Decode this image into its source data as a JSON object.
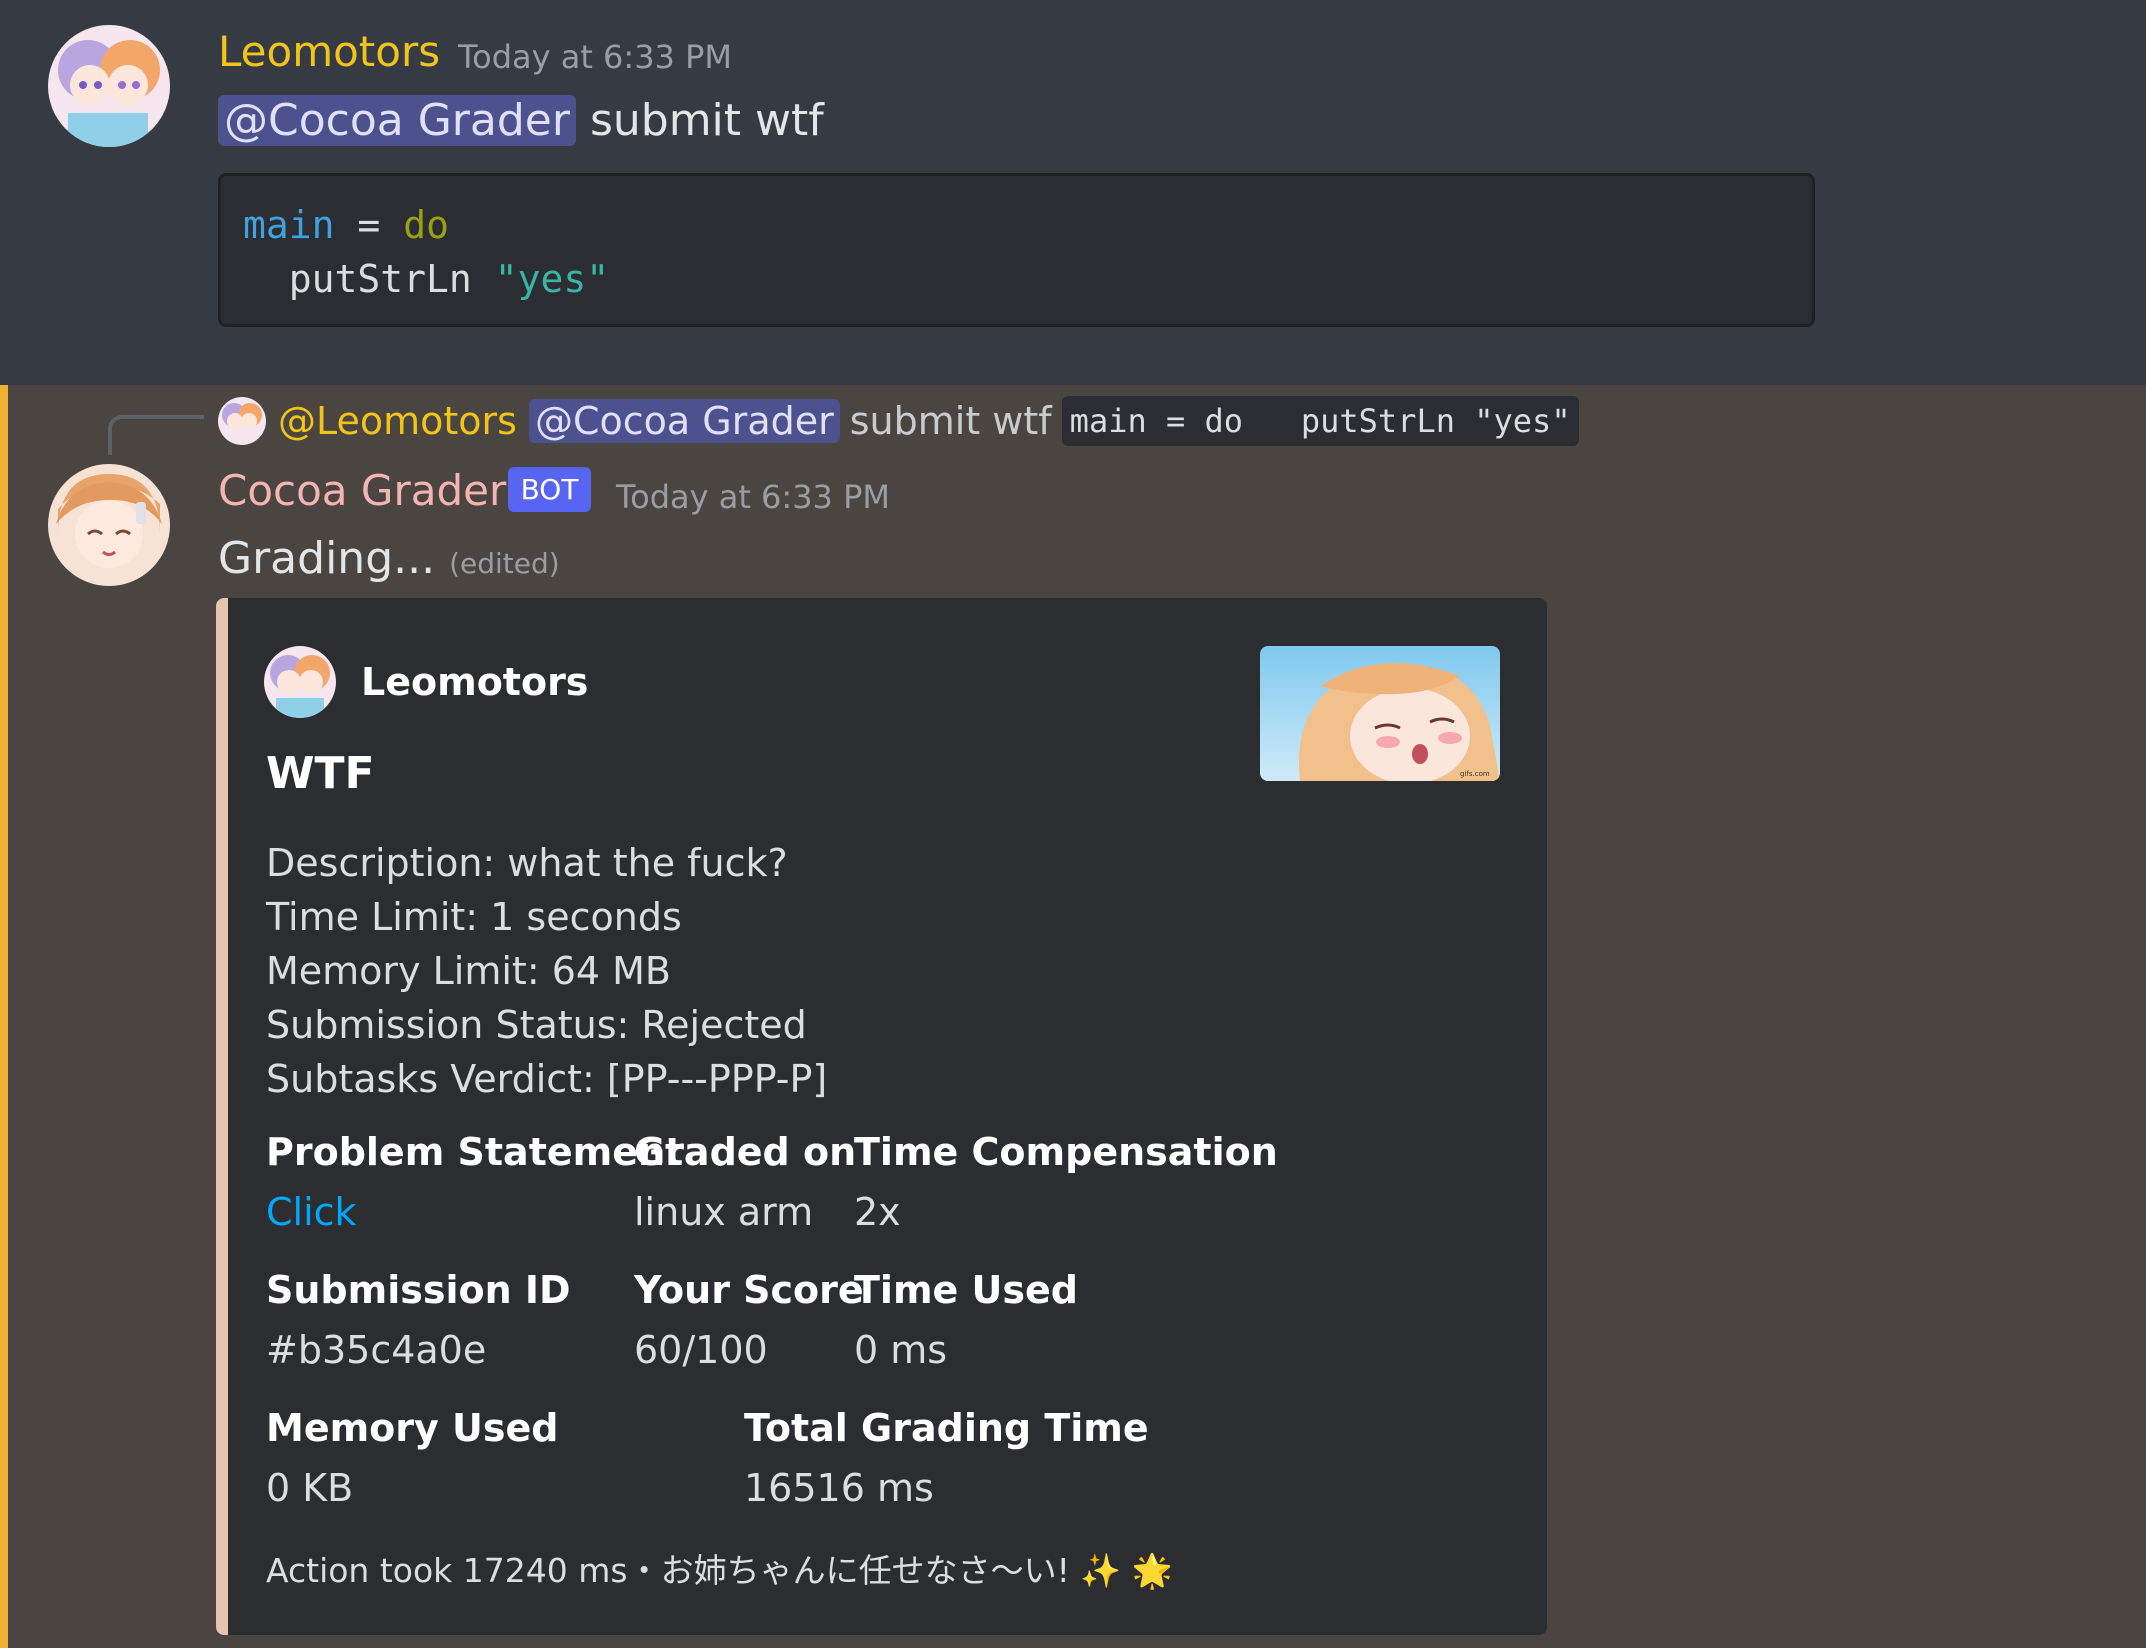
{
  "message1": {
    "author": "Leomotors",
    "timestamp": "Today at 6:33 PM",
    "mention": "@Cocoa Grader",
    "text": "submit wtf",
    "code_line1_a": "main",
    "code_line1_b": "=",
    "code_line1_c": "do",
    "code_line2_a": "putStrLn",
    "code_line2_b": "\"yes\""
  },
  "message2": {
    "reply_author": "@Leomotors",
    "reply_mention": "@Cocoa Grader",
    "reply_text": "submit wtf",
    "reply_code": "main = do   putStrLn \"yes\"",
    "author": "Cocoa Grader",
    "bot_tag": "BOT",
    "timestamp": "Today at 6:33 PM",
    "text": "Grading...",
    "edited": "(edited)"
  },
  "embed": {
    "author": "Leomotors",
    "title": "WTF",
    "description": [
      "Description: what the fuck?",
      "Time Limit: 1 seconds",
      "Memory Limit: 64 MB",
      "Submission Status: Rejected",
      "Subtasks Verdict: [PP---PPP-P]"
    ],
    "fields": {
      "problem_statement": {
        "name": "Problem Statement",
        "value": "Click"
      },
      "graded_on": {
        "name": "Graded on",
        "value": "linux arm"
      },
      "time_compensation": {
        "name": "Time Compensation",
        "value": "2x"
      },
      "submission_id": {
        "name": "Submission ID",
        "value": "#b35c4a0e"
      },
      "your_score": {
        "name": "Your Score",
        "value": "60/100"
      },
      "time_used": {
        "name": "Time Used",
        "value": "0 ms"
      },
      "memory_used": {
        "name": "Memory Used",
        "value": "0 KB"
      },
      "total_grading_time": {
        "name": "Total Grading Time",
        "value": "16516 ms"
      }
    },
    "footer": "Action took 17240 ms・お姉ちゃんに任せなさ〜い! ✨ 🌟",
    "thumbnail_watermark": "gifs.com"
  },
  "colors": {
    "author1": "#f0c419",
    "author2": "#f4b4b4",
    "mention_bar": "#f0b132",
    "embed_bar": "#e7c4b0",
    "bot_tag": "#5865f2",
    "link": "#00a8fc"
  }
}
